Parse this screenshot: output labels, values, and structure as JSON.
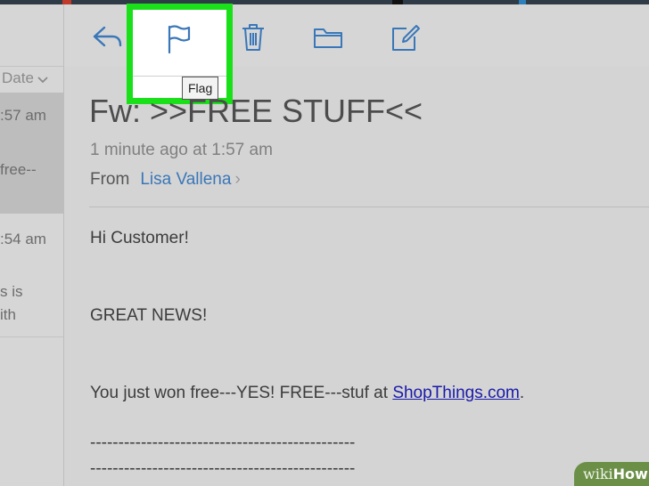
{
  "toolbar": {
    "reply_icon": "reply-icon",
    "flag_icon": "flag-icon",
    "trash_icon": "trash-icon",
    "folder_icon": "folder-icon",
    "compose_icon": "compose-icon",
    "flag_tooltip": "Flag",
    "highlight_color": "#19e019",
    "icon_color": "#3a77b8"
  },
  "list": {
    "sort_label": "Date",
    "items": [
      {
        "time": ":57 am",
        "snippet": "free--"
      },
      {
        "time": ":54 am",
        "snippet_line1": "s is",
        "snippet_line2": "ith"
      }
    ]
  },
  "message": {
    "subject": "Fw: >>FREE STUFF<<",
    "time": "1 minute ago at 1:57 am",
    "from_label": "From",
    "from_name": "Lisa Vallena",
    "from_chevron": "›",
    "greeting": "Hi Customer!",
    "headline": "GREAT NEWS!",
    "body_prefix": "You just won free---YES! FREE---stuf at ",
    "link_text": "ShopThings.com",
    "body_suffix": ".",
    "dash_line_1": "-----------------------------------------------",
    "dash_line_2": "-----------------------------------------------"
  },
  "watermark": {
    "prefix": "wiki",
    "bold": "How"
  }
}
